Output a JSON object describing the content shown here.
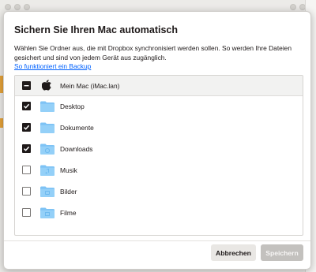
{
  "dialog": {
    "title": "Sichern Sie Ihren Mac automatisch",
    "description": "Wählen Sie Ordner aus, die mit Dropbox synchronisiert werden sollen. So werden Ihre Dateien gesichert und sind von jedem Gerät aus zugänglich.",
    "help_link": "So funktioniert ein Backup"
  },
  "list": {
    "header": {
      "label": "Mein Mac (iMac.lan)",
      "state": "mixed",
      "icon": "apple-icon"
    },
    "items": [
      {
        "label": "Desktop",
        "checked": true,
        "icon": "folder-icon"
      },
      {
        "label": "Dokumente",
        "checked": true,
        "icon": "folder-icon"
      },
      {
        "label": "Downloads",
        "checked": true,
        "icon": "folder-icon"
      },
      {
        "label": "Musik",
        "checked": false,
        "icon": "folder-icon"
      },
      {
        "label": "Bilder",
        "checked": false,
        "icon": "folder-icon"
      },
      {
        "label": "Filme",
        "checked": false,
        "icon": "folder-icon"
      }
    ]
  },
  "buttons": {
    "cancel_label": "Abbrechen",
    "save_label": "Speichern"
  },
  "colors": {
    "link": "#0061fe",
    "folder": "#7ec3f5",
    "checkbox_checked": "#1e1919"
  }
}
